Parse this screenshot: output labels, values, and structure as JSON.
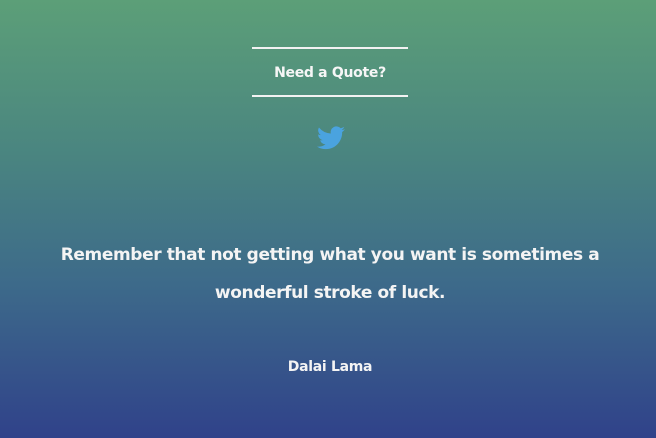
{
  "header": {
    "title": "Need a Quote?"
  },
  "share": {
    "icon": "twitter-icon",
    "color": "#4aa3df"
  },
  "quote": {
    "text": "Remember that not getting what you want is sometimes a wonderful stroke of luck.",
    "author": "Dalai Lama"
  },
  "colors": {
    "gradient_top": "#5c9f78",
    "gradient_bottom": "#30428a",
    "text": "#f4f4f4"
  }
}
